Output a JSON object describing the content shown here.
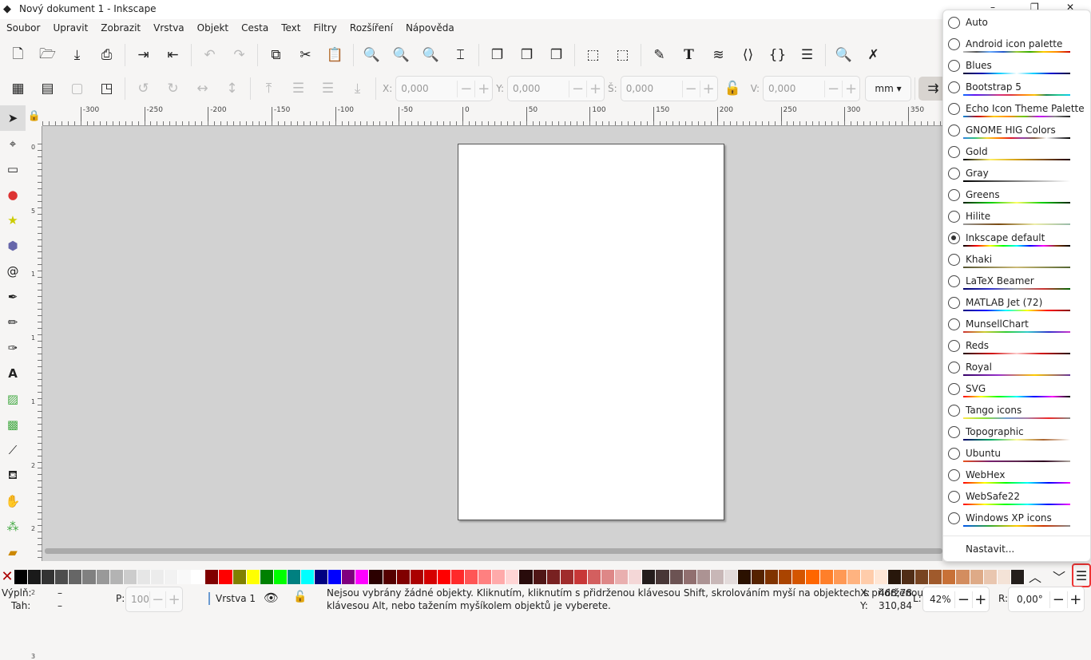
{
  "window": {
    "title": "Nový dokument 1 - Inkscape",
    "controls": [
      "–",
      "❐",
      "✕"
    ]
  },
  "menubar": [
    "Soubor",
    "Upravit",
    "Zobrazit",
    "Vrstva",
    "Objekt",
    "Cesta",
    "Text",
    "Filtry",
    "Rozšíření",
    "Nápověda"
  ],
  "toolbar": {
    "x_label": "X:",
    "x_value": "0,000",
    "y_label": "Y:",
    "y_value": "0,000",
    "w_label": "Š:",
    "w_value": "0,000",
    "h_label": "V:",
    "h_value": "0,000",
    "unit": "mm"
  },
  "ruler": {
    "h_ticks": [
      "-300",
      "-250",
      "-200",
      "-150",
      "-100",
      "-50",
      "0",
      "50",
      "100",
      "150",
      "200",
      "250",
      "300",
      "350"
    ],
    "v_ticks": [
      "0",
      "5",
      "1",
      "1",
      "1",
      "2",
      "2",
      "2",
      "3"
    ]
  },
  "palette_swatches": [
    "#000000",
    "#1a1a1a",
    "#333333",
    "#4d4d4d",
    "#666666",
    "#808080",
    "#999999",
    "#b3b3b3",
    "#cccccc",
    "#e6e6e6",
    "#ececec",
    "#f2f2f2",
    "#f9f9f9",
    "#ffffff",
    "#800000",
    "#ff0000",
    "#808000",
    "#ffff00",
    "#008000",
    "#00ff00",
    "#008080",
    "#00ffff",
    "#000080",
    "#0000ff",
    "#800080",
    "#ff00ff",
    "#2b0000",
    "#550000",
    "#800000",
    "#aa0000",
    "#d40000",
    "#ff0000",
    "#ff2a2a",
    "#ff5555",
    "#ff8080",
    "#ffaaaa",
    "#ffd5d5",
    "#280b0b",
    "#501616",
    "#782121",
    "#a02c2c",
    "#c83737",
    "#d35f5f",
    "#de8787",
    "#e9afaf",
    "#f4d7d7",
    "#241c1c",
    "#483737",
    "#6c5353",
    "#916f6f",
    "#ac9393",
    "#c8b7b7",
    "#e3dbdb",
    "#2b1100",
    "#552200",
    "#803300",
    "#aa4400",
    "#d45500",
    "#ff6600",
    "#ff7f2a",
    "#ff9955",
    "#ffb380",
    "#ffccaa",
    "#ffe6d5",
    "#28170b",
    "#502d16",
    "#784421",
    "#a05a2c",
    "#c87137",
    "#d38d5f",
    "#deaa87",
    "#e9c6af",
    "#f4e3d7",
    "#241f1c"
  ],
  "palette_menu": {
    "selected": "Inkscape default",
    "items": [
      {
        "name": "Auto",
        "colors": []
      },
      {
        "name": "Android icon palette",
        "colors": [
          "#bbbbbb",
          "#555555",
          "#66aaff",
          "#2255cc",
          "#99cc33",
          "#33aa00",
          "#ffcc00",
          "#ff8800",
          "#cc0000"
        ]
      },
      {
        "name": "Blues",
        "colors": [
          "#000033",
          "#0000aa",
          "#00ccff",
          "#ffffff",
          "#00ccff",
          "#0000cc",
          "#000033"
        ]
      },
      {
        "name": "Bootstrap 5",
        "colors": [
          "#0d6efd",
          "#6610f2",
          "#6f42c1",
          "#d63384",
          "#dc3545",
          "#fd7e14",
          "#ffc107",
          "#198754",
          "#20c997",
          "#0dcaf0"
        ]
      },
      {
        "name": "Echo Icon Theme Palette",
        "colors": [
          "#0088dd",
          "#cc0000",
          "#ffcc00",
          "#ff8800",
          "#66cc00",
          "#cc00ff",
          "#888888",
          "#222222"
        ]
      },
      {
        "name": "GNOME HIG Colors",
        "colors": [
          "#3584e4",
          "#2ec27e",
          "#f6d32d",
          "#ff7800",
          "#e01b24",
          "#9141ac",
          "#865e3c",
          "#ffffff",
          "#77767b",
          "#000000"
        ]
      },
      {
        "name": "Gold",
        "colors": [
          "#000000",
          "#fff066",
          "#d4a017",
          "#805020",
          "#200000"
        ]
      },
      {
        "name": "Gray",
        "colors": [
          "#000000",
          "#808080",
          "#ffffff"
        ]
      },
      {
        "name": "Greens",
        "colors": [
          "#002200",
          "#00cc00",
          "#ffff66",
          "#00cc00",
          "#002200"
        ]
      },
      {
        "name": "Hilite",
        "colors": [
          "#999999",
          "#7a4a10",
          "#eeeeaa",
          "#99bbaa"
        ]
      },
      {
        "name": "Inkscape default",
        "colors": [
          "#000000",
          "#ff0000",
          "#ffff00",
          "#00ff00",
          "#00ffff",
          "#0000ff",
          "#ff00ff",
          "#803300",
          "#000000"
        ]
      },
      {
        "name": "Khaki",
        "colors": [
          "#555533",
          "#ccbb77",
          "#556633"
        ]
      },
      {
        "name": "LaTeX Beamer",
        "colors": [
          "#000066",
          "#3333cc",
          "#999999",
          "#cc3333",
          "#006600"
        ]
      },
      {
        "name": "MATLAB Jet (72)",
        "colors": [
          "#000080",
          "#0000ff",
          "#00ffff",
          "#ffff00",
          "#ff0000",
          "#800000"
        ]
      },
      {
        "name": "MunsellChart",
        "colors": [
          "#cc3333",
          "#cccc33",
          "#33cc33",
          "#33cccc",
          "#3333cc",
          "#cc33cc"
        ]
      },
      {
        "name": "Reds",
        "colors": [
          "#220000",
          "#cc0000",
          "#ffcccc",
          "#cc0000",
          "#220000"
        ]
      },
      {
        "name": "Royal",
        "colors": [
          "#330066",
          "#9933cc",
          "#ffcc00",
          "#663399"
        ]
      },
      {
        "name": "SVG",
        "colors": [
          "#ff0000",
          "#ffff00",
          "#00ff00",
          "#00ffff",
          "#0000ff",
          "#ff00ff",
          "#000000"
        ]
      },
      {
        "name": "Tango icons",
        "colors": [
          "#fce94f",
          "#8ae234",
          "#729fcf",
          "#ad7fa8",
          "#ef2929",
          "#888a85"
        ]
      },
      {
        "name": "Topographic",
        "colors": [
          "#000066",
          "#00aa66",
          "#ffff99",
          "#aa6633",
          "#ffffff"
        ]
      },
      {
        "name": "Ubuntu",
        "colors": [
          "#e95420",
          "#77216f",
          "#5e2750",
          "#2c001e",
          "#aea79f"
        ]
      },
      {
        "name": "WebHex",
        "colors": [
          "#ff0000",
          "#ffff00",
          "#00ff00",
          "#00ffff",
          "#0000ff",
          "#ff00ff"
        ]
      },
      {
        "name": "WebSafe22",
        "colors": [
          "#ff0000",
          "#ffff00",
          "#00ff00",
          "#00ffff",
          "#0000ff",
          "#ff00ff"
        ]
      },
      {
        "name": "Windows XP icons",
        "colors": [
          "#0055ee",
          "#33aa33",
          "#ffcc00",
          "#cc3300",
          "#888888"
        ]
      }
    ],
    "settings_label": "Nastavit..."
  },
  "status": {
    "fill_label": "Výplň:",
    "fill_value": "–",
    "stroke_label": "Tah:",
    "stroke_value": "–",
    "opacity_label": "P:",
    "opacity_value": "100",
    "layer": "Vrstva 1",
    "message_line1": "Nejsou vybrány žádné objekty. Kliknutím, kliknutím s přidrženou klávesou Shift, skrolováním myší na objektech s přidrženou",
    "message_line2": "klávesou Alt, nebo tažením myšíkolem objektů je vyberete.",
    "x_label": "X:",
    "x_value": "468,78",
    "y_label": "Y:",
    "y_value": "310,84",
    "zoom_label": "L:",
    "zoom_value": "42%",
    "rotate_label": "R:",
    "rotate_value": "0,00°"
  }
}
